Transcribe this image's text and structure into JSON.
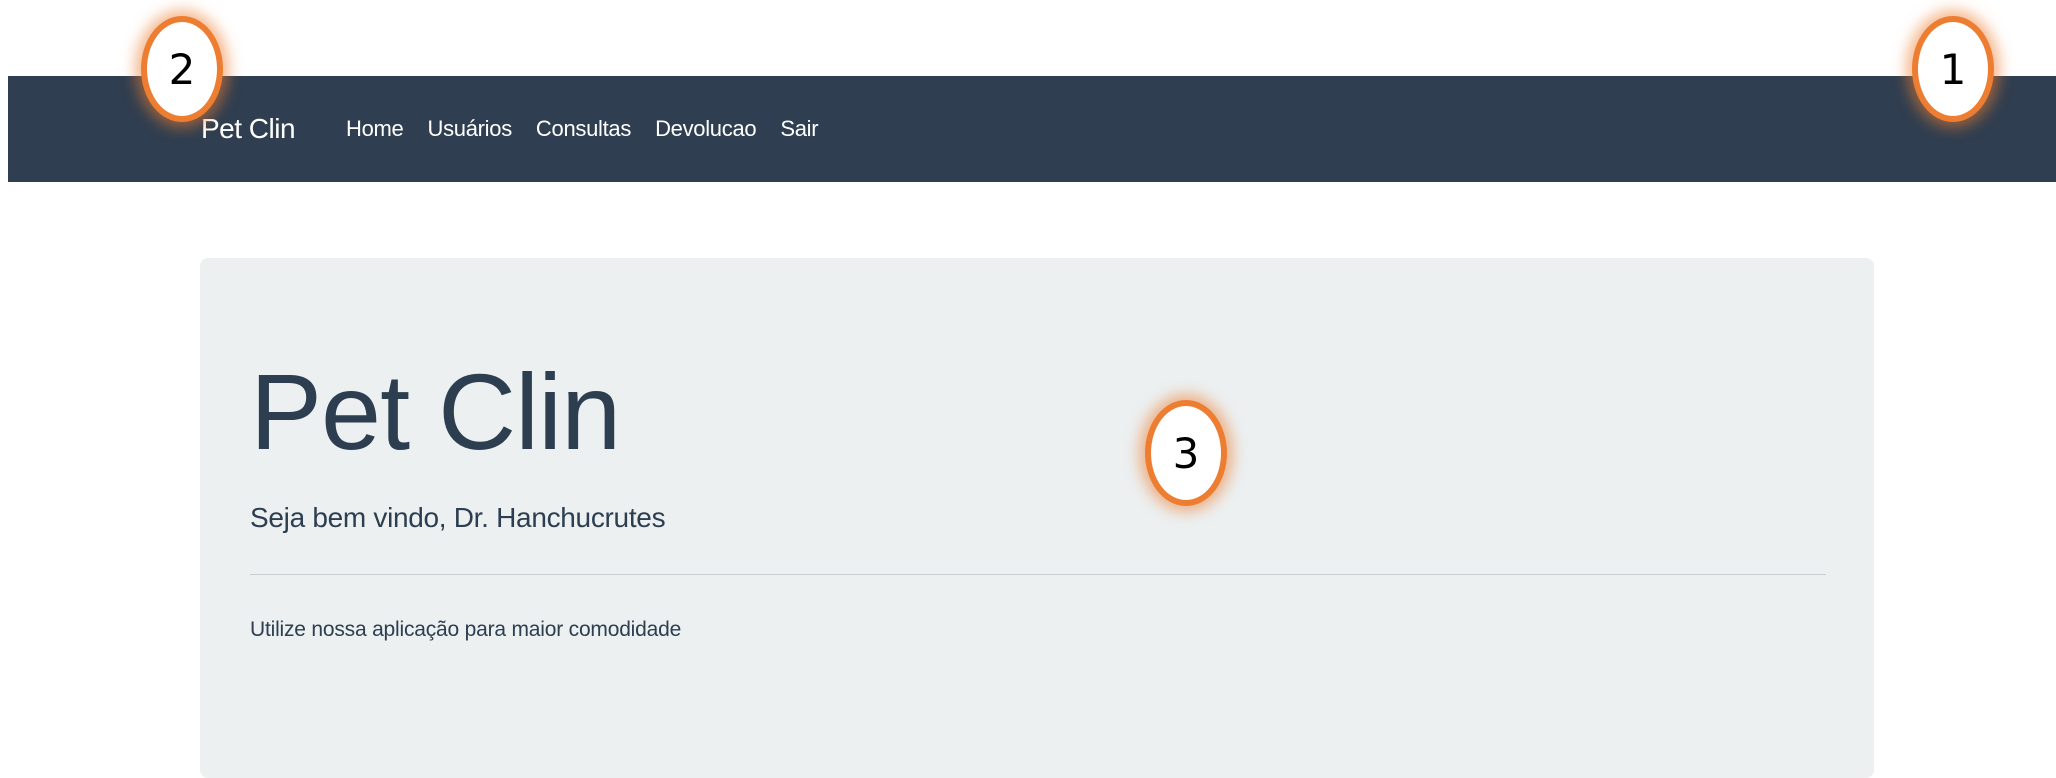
{
  "navbar": {
    "brand": "Pet Clin",
    "links": [
      {
        "label": "Home"
      },
      {
        "label": "Usuários"
      },
      {
        "label": "Consultas"
      },
      {
        "label": "Devolucao"
      },
      {
        "label": "Sair"
      }
    ],
    "background_color": "#2f3e50"
  },
  "jumbotron": {
    "title": "Pet Clin",
    "lead": "Seja bem vindo, Dr. Hanchucrutes",
    "text": "Utilize nossa aplicação para maior comodidade",
    "background_color": "#ecf0f1"
  },
  "markers": [
    {
      "label": "1"
    },
    {
      "label": "2"
    },
    {
      "label": "3"
    }
  ],
  "marker_color": "#ed7d31"
}
